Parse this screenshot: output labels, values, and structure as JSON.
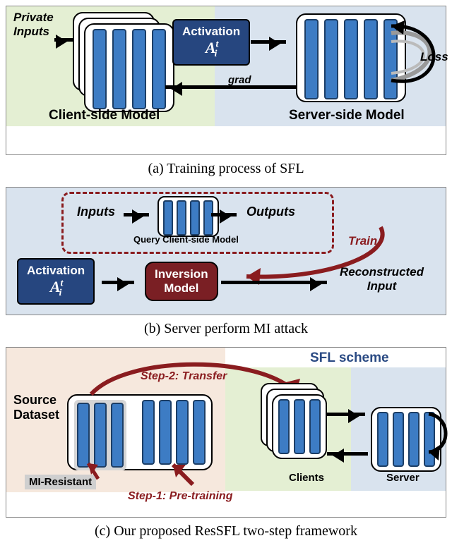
{
  "panelA": {
    "caption": "(a) Training process of SFL",
    "privateInputs": "Private\nInputs",
    "activationLabel": "Activation",
    "activationFormula": "A",
    "activationSub": "i",
    "activationSup": "t",
    "loss": "Loss",
    "grad": "grad",
    "clientModel": "Client-side Model",
    "serverModel": "Server-side Model"
  },
  "panelB": {
    "caption": "(b) Server perform MI attack",
    "inputs": "Inputs",
    "outputs": "Outputs",
    "queryLabel": "Query Client-side Model",
    "train": "Train",
    "activationLabel": "Activation",
    "activationFormula": "A",
    "activationSub": "i",
    "activationSup": "t",
    "inversion": "Inversion\nModel",
    "reconstructed": "Reconstructed\nInput"
  },
  "panelC": {
    "caption": "(c) Our proposed ResSFL two-step framework",
    "source": "Source\nDataset",
    "miResistant": "MI-Resistant",
    "step1": "Step-1: Pre-training",
    "step2": "Step-2: Transfer",
    "sfl": "SFL scheme",
    "clients": "Clients",
    "server": "Server"
  }
}
